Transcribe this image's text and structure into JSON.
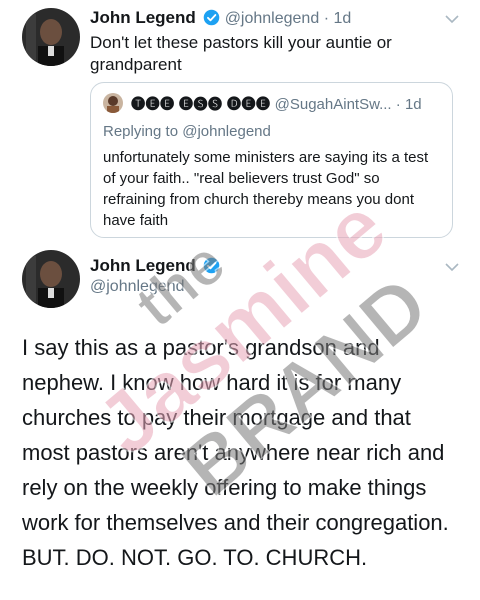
{
  "tweet1": {
    "author_name": "John Legend",
    "handle": "@johnlegend",
    "separator": "·",
    "time": "1d",
    "text": "Don't let these pastors kill your auntie or grandparent",
    "icons": [
      "avatar",
      "verified-badge-icon",
      "chevron-down-icon"
    ]
  },
  "quoted": {
    "author_name": "🅣🅔🅔 🅔🅢🅢 🅓🅔🅔",
    "handle": "@SugahAintSw...",
    "separator": "·",
    "time": "1d",
    "replying_prefix": "Replying to ",
    "replying_to": "@johnlegend",
    "text": "unfortunately some ministers are saying its a test of your faith.. \"real believers trust God\" so refraining from church thereby means you dont have faith"
  },
  "tweet2": {
    "author_name": "John Legend",
    "handle": "@johnlegend",
    "text": "I say this as a pastor's grandson and nephew.  I know how hard it is for many churches to pay their mortgage and that most pastors aren't anywhere near rich and rely on the weekly offering to make things work for themselves and their congregation.  BUT. DO. NOT. GO. TO. CHURCH."
  },
  "watermark": {
    "line1": "the",
    "line2": "Jasmine",
    "line3": "BRAND"
  },
  "colors": {
    "verified_blue": "#1da1f2",
    "secondary_text": "#657786",
    "border": "#ccd6dd",
    "watermark_gray": "#7a7a7a",
    "watermark_pink": "#e8a6b8"
  }
}
